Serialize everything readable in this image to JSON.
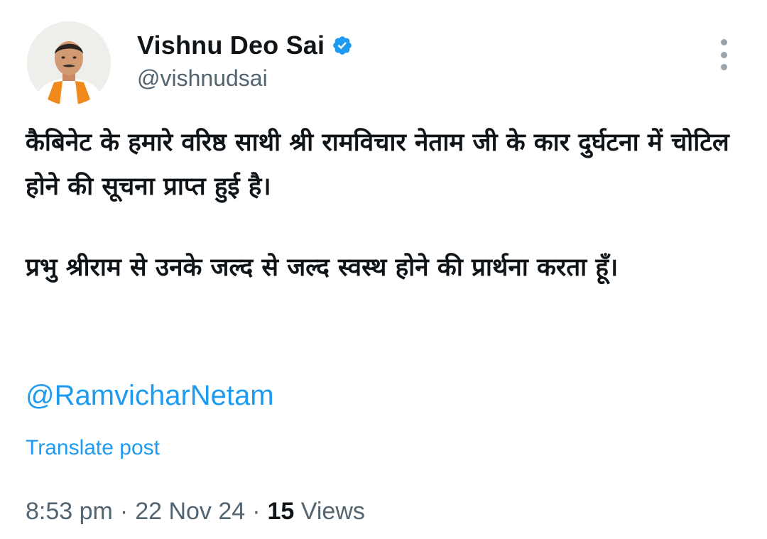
{
  "author": {
    "name": "Vishnu Deo Sai",
    "handle": "@vishnudsai",
    "verified": true,
    "avatar_icon": "profile-photo"
  },
  "tweet": {
    "paragraphs": [
      "कैबिनेट के हमारे वरिष्ठ साथी श्री रामविचार नेताम जी के कार दुर्घटना में चोटिल होने की सूचना प्राप्त हुई है।",
      "प्रभु श्रीराम से उनके जल्द से जल्द स्वस्थ होने की प्रार्थना करता हूँ।"
    ],
    "mention": "@RamvicharNetam",
    "translate_label": "Translate post"
  },
  "meta": {
    "time": "8:53 pm",
    "date": "22 Nov 24",
    "views_count": "15",
    "views_label": "Views",
    "separator": "·"
  },
  "colors": {
    "link": "#1d9bf0",
    "secondary_text": "#536471",
    "primary_text": "#0f1419",
    "verified_badge": "#1d9bf0"
  }
}
